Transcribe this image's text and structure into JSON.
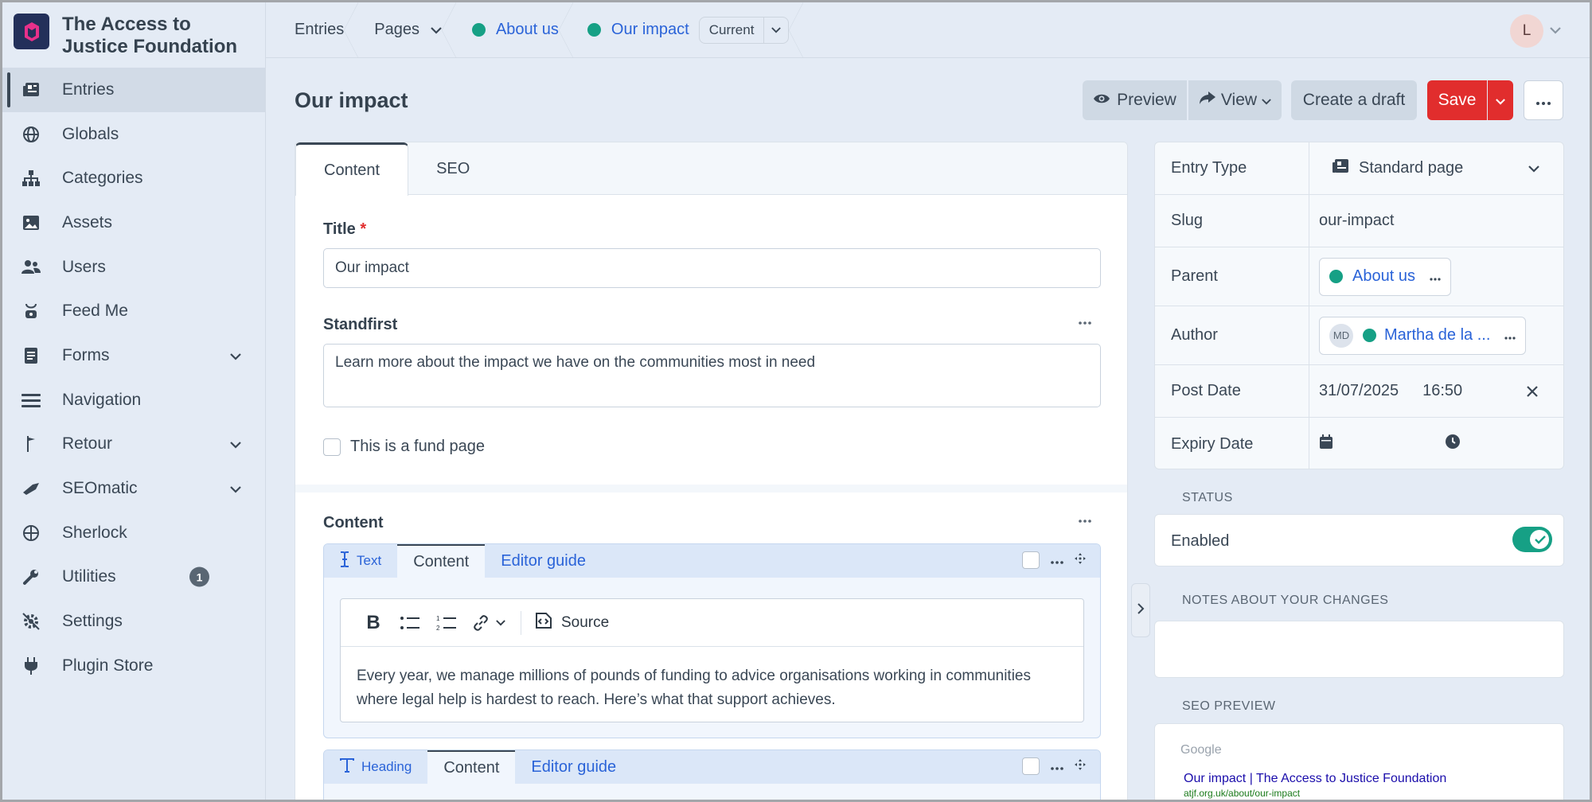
{
  "site": {
    "name": "The Access to Justice Foundation"
  },
  "nav": {
    "items": [
      {
        "label": "Entries"
      },
      {
        "label": "Globals"
      },
      {
        "label": "Categories"
      },
      {
        "label": "Assets"
      },
      {
        "label": "Users"
      },
      {
        "label": "Feed Me"
      },
      {
        "label": "Forms"
      },
      {
        "label": "Navigation"
      },
      {
        "label": "Retour"
      },
      {
        "label": "SEOmatic"
      },
      {
        "label": "Sherlock"
      },
      {
        "label": "Utilities",
        "badge": "1"
      },
      {
        "label": "Settings"
      },
      {
        "label": "Plugin Store"
      }
    ]
  },
  "breadcrumb": {
    "entries": "Entries",
    "pages": "Pages",
    "about": "About us",
    "impact": "Our impact",
    "current": "Current"
  },
  "user": {
    "initial": "L"
  },
  "page": {
    "title": "Our impact",
    "preview": "Preview",
    "view": "View",
    "create_draft": "Create a draft",
    "save": "Save"
  },
  "tabs": {
    "content": "Content",
    "seo": "SEO"
  },
  "form": {
    "title_label": "Title",
    "title_required": "*",
    "title_value": "Our impact",
    "standfirst_label": "Standfirst",
    "standfirst_value": "Learn more about the impact we have on the communities most in need",
    "fund_label": "This is a fund page",
    "content_label": "Content"
  },
  "blocks": {
    "text": {
      "type": "Text",
      "tab_content": "Content",
      "tab_guide": "Editor guide",
      "source": "Source",
      "body": "Every year, we manage millions of pounds of funding to advice organisations working in communities where legal help is hardest to reach.  Here’s what that support achieves."
    },
    "heading": {
      "type": "Heading",
      "tab_content": "Content",
      "tab_guide": "Editor guide"
    }
  },
  "meta": {
    "entry_type_label": "Entry Type",
    "entry_type_value": "Standard page",
    "slug_label": "Slug",
    "slug_value": "our-impact",
    "parent_label": "Parent",
    "parent_value": "About us",
    "author_label": "Author",
    "author_initials": "MD",
    "author_value": "Martha de la ...",
    "post_date_label": "Post Date",
    "post_date": "31/07/2025",
    "post_time": "16:50",
    "expiry_label": "Expiry Date"
  },
  "status": {
    "heading": "STATUS",
    "enabled_label": "Enabled",
    "enabled": true
  },
  "notes": {
    "heading": "NOTES ABOUT YOUR CHANGES"
  },
  "seo_preview": {
    "heading": "SEO PREVIEW",
    "engine": "Google",
    "title": "Our impact | The Access to Justice Foundation",
    "url": "atjf.org.uk/about/our-impact"
  },
  "colors": {
    "accent": "#2a63d8",
    "danger": "#e12d2d",
    "success": "#16a085"
  }
}
